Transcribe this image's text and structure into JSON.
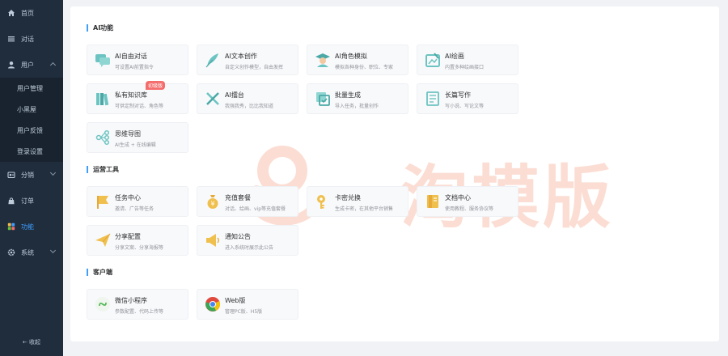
{
  "sidebar": {
    "items": [
      {
        "label": "首页",
        "icon": "home-icon"
      },
      {
        "label": "对话",
        "icon": "list-icon"
      },
      {
        "label": "用户",
        "icon": "user-icon"
      },
      {
        "label": "分销",
        "icon": "share-icon"
      },
      {
        "label": "订单",
        "icon": "bag-icon"
      },
      {
        "label": "功能",
        "icon": "grid-icon"
      },
      {
        "label": "系统",
        "icon": "settings-icon"
      }
    ],
    "user_sub": [
      "用户管理",
      "小黑屋",
      "用户反馈",
      "登录设置"
    ],
    "collapse_label": "收起",
    "active_color": "#409eff"
  },
  "sections": [
    {
      "title": "AI功能",
      "cards": [
        {
          "name": "AI自由对话",
          "desc": "可设置AI前置指令",
          "icon": "chat-bubble-icon",
          "color": "#6cc4c2"
        },
        {
          "name": "AI文本创作",
          "desc": "自定义创作模型，自由发挥",
          "icon": "feather-icon",
          "color": "#6cc4c2"
        },
        {
          "name": "AI角色模拟",
          "desc": "模拟各种身份、职位、专家",
          "icon": "graduate-icon",
          "color": "#6cc4c2"
        },
        {
          "name": "AI绘画",
          "desc": "内置多种绘画接口",
          "icon": "painting-icon",
          "color": "#6cc4c2"
        },
        {
          "name": "私有知识库",
          "desc": "可供定制对话、角色等",
          "icon": "books-icon",
          "color": "#6cc4c2",
          "badge": "初级版"
        },
        {
          "name": "AI擂台",
          "desc": "我强我秀，比比我知道",
          "icon": "swords-icon",
          "color": "#6cc4c2"
        },
        {
          "name": "批量生成",
          "desc": "导入任务，批量创作",
          "icon": "batch-icon",
          "color": "#6cc4c2"
        },
        {
          "name": "长篇写作",
          "desc": "写小说、写论文等",
          "icon": "document-icon",
          "color": "#6cc4c2"
        },
        {
          "name": "思维导图",
          "desc": "AI生成 + 在线编辑",
          "icon": "mindmap-icon",
          "color": "#6cc4c2"
        }
      ]
    },
    {
      "title": "运营工具",
      "cards": [
        {
          "name": "任务中心",
          "desc": "邀请、广告等任务",
          "icon": "flag-icon",
          "color": "#f0c04f"
        },
        {
          "name": "充值套餐",
          "desc": "对话、绘画、vip等充值套餐",
          "icon": "money-bag-icon",
          "color": "#f0c04f"
        },
        {
          "name": "卡密兑换",
          "desc": "生成卡密，在其他平台销售",
          "icon": "key-icon",
          "color": "#f0c04f"
        },
        {
          "name": "文档中心",
          "desc": "使用教程、服务协议等",
          "icon": "doc-center-icon",
          "color": "#f0c04f"
        },
        {
          "name": "分享配置",
          "desc": "分享文案、分享海报等",
          "icon": "paper-plane-icon",
          "color": "#f0c04f"
        },
        {
          "name": "通知公告",
          "desc": "进入系统时展示此公告",
          "icon": "megaphone-icon",
          "color": "#f0c04f"
        }
      ]
    },
    {
      "title": "客户端",
      "cards": [
        {
          "name": "微信小程序",
          "desc": "参数配置、代码上传等",
          "icon": "miniprogram-icon",
          "color": "#57b85c"
        },
        {
          "name": "Web版",
          "desc": "管理PC版、H5版",
          "icon": "chrome-icon",
          "color": "#e04a3c"
        }
      ]
    }
  ],
  "watermark": {
    "text": "一淘模版"
  }
}
